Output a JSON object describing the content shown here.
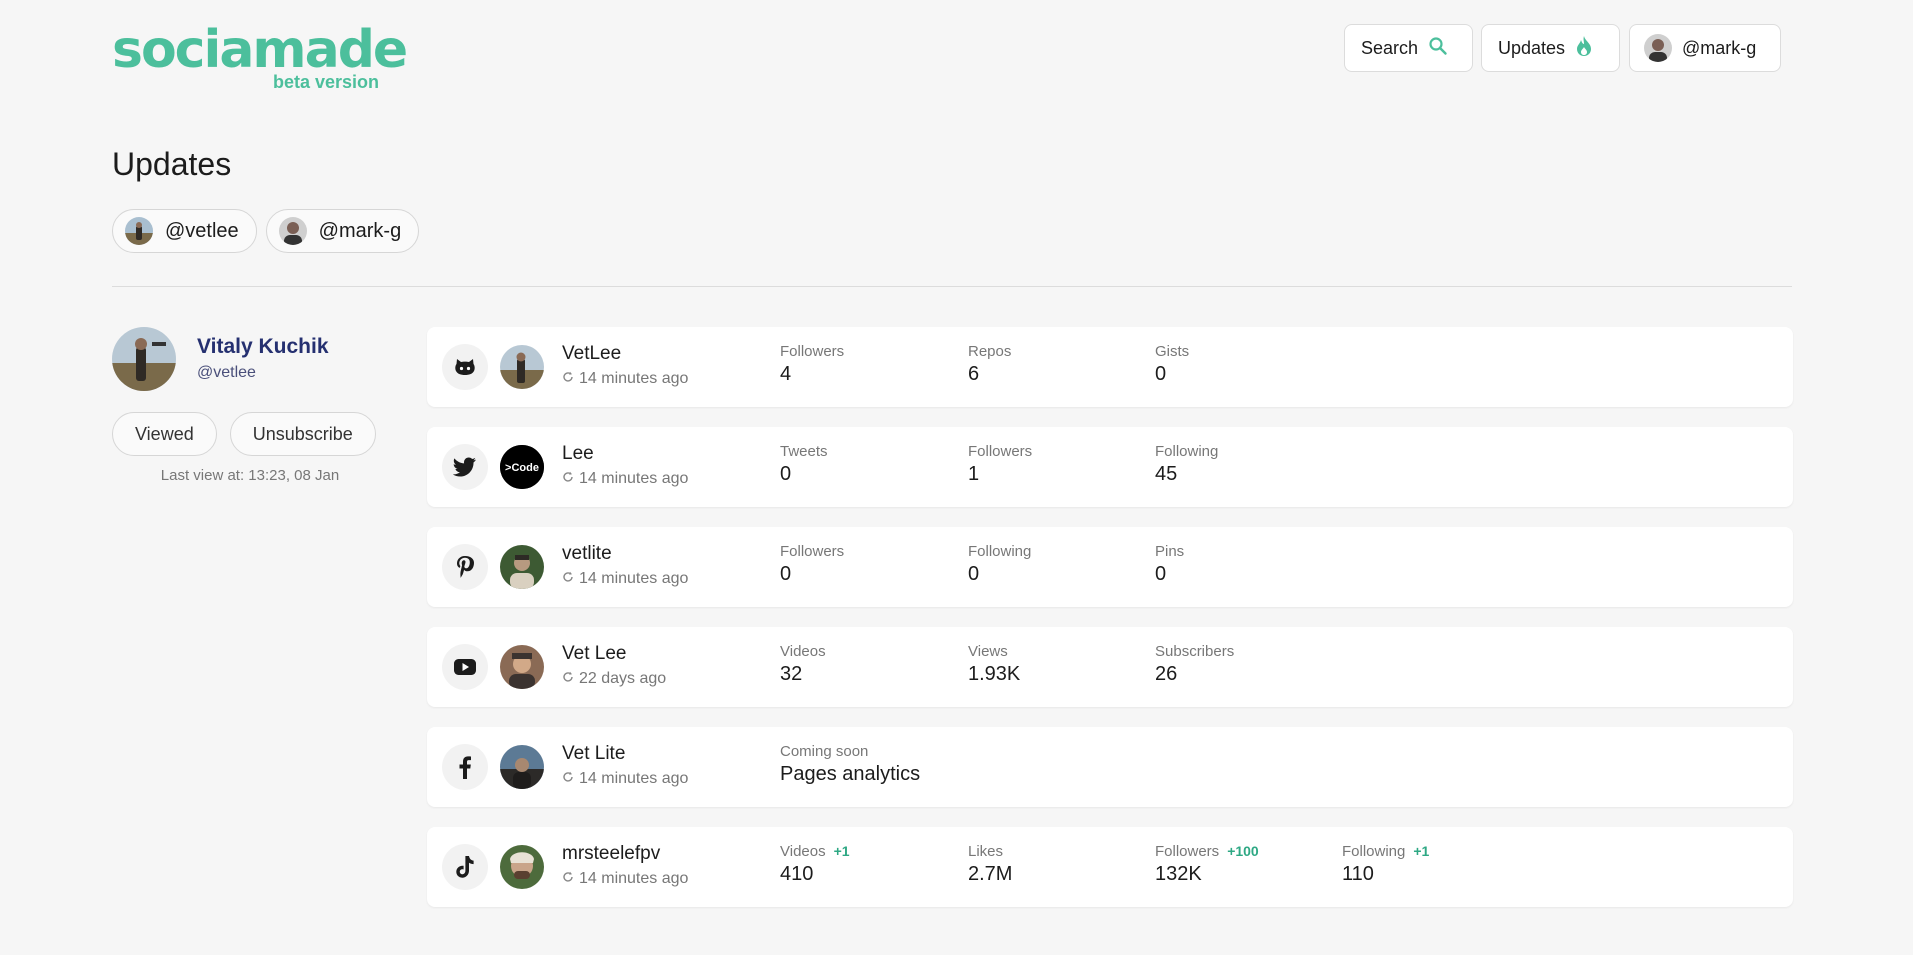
{
  "logo": {
    "wordmark": "sociamade",
    "subtitle": "beta version"
  },
  "nav": {
    "search": "Search",
    "updates": "Updates",
    "account": "@mark-g"
  },
  "page": {
    "title": "Updates"
  },
  "chips": [
    "@vetlee",
    "@mark-g"
  ],
  "profile": {
    "name": "Vitaly Kuchik",
    "handle": "@vetlee",
    "viewed": "Viewed",
    "unsubscribe": "Unsubscribe",
    "last_view": "Last view at: 13:23, 08 Jan"
  },
  "accounts": [
    {
      "network": "github-icon",
      "name": "VetLee",
      "updated": "14 minutes ago",
      "stats": [
        {
          "label": "Followers",
          "value": "4"
        },
        {
          "label": "Repos",
          "value": "6"
        },
        {
          "label": "Gists",
          "value": "0"
        }
      ]
    },
    {
      "network": "twitter-icon",
      "name": "Lee",
      "updated": "14 minutes ago",
      "avatar_text": ">Code",
      "stats": [
        {
          "label": "Tweets",
          "value": "0"
        },
        {
          "label": "Followers",
          "value": "1"
        },
        {
          "label": "Following",
          "value": "45"
        }
      ]
    },
    {
      "network": "pinterest-icon",
      "name": "vetlite",
      "updated": "14 minutes ago",
      "stats": [
        {
          "label": "Followers",
          "value": "0"
        },
        {
          "label": "Following",
          "value": "0"
        },
        {
          "label": "Pins",
          "value": "0"
        }
      ]
    },
    {
      "network": "youtube-icon",
      "name": "Vet Lee",
      "updated": "22 days ago",
      "stats": [
        {
          "label": "Videos",
          "value": "32"
        },
        {
          "label": "Views",
          "value": "1.93K"
        },
        {
          "label": "Subscribers",
          "value": "26"
        }
      ]
    },
    {
      "network": "facebook-icon",
      "name": "Vet Lite",
      "updated": "14 minutes ago",
      "stats": [
        {
          "label": "Coming soon",
          "value": "Pages analytics"
        }
      ]
    },
    {
      "network": "tiktok-icon",
      "name": "mrsteelefpv",
      "updated": "14 minutes ago",
      "stats": [
        {
          "label": "Videos",
          "delta": "+1",
          "value": "410"
        },
        {
          "label": "Likes",
          "value": "2.7M"
        },
        {
          "label": "Followers",
          "delta": "+100",
          "value": "132K"
        },
        {
          "label": "Following",
          "delta": "+1",
          "value": "110"
        }
      ]
    }
  ],
  "colors": {
    "accent": "#4cbf9c",
    "delta": "#2ea884",
    "profile_name": "#253070",
    "background": "#f6f6f6"
  }
}
